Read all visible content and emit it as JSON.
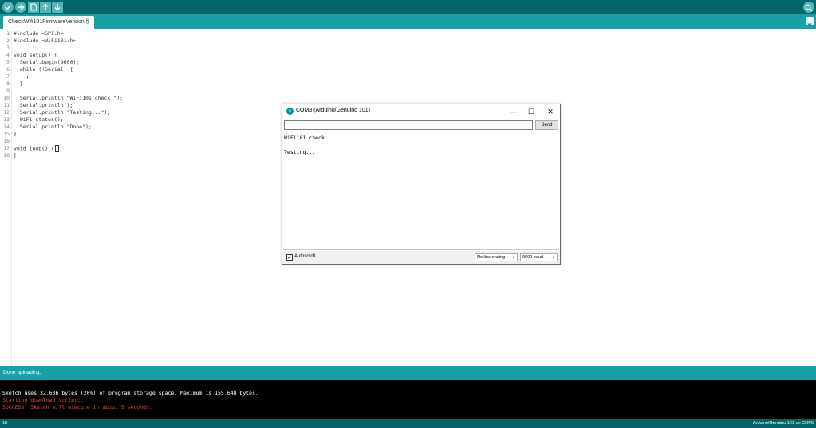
{
  "toolbar": {
    "buttons": [
      {
        "name": "verify",
        "icon": "checkmark-icon"
      },
      {
        "name": "upload",
        "icon": "arrow-right-icon"
      },
      {
        "name": "new",
        "icon": "new-file-icon"
      },
      {
        "name": "open",
        "icon": "arrow-up-icon"
      },
      {
        "name": "save",
        "icon": "arrow-down-icon"
      }
    ],
    "serial_monitor_icon": "magnifier-icon"
  },
  "tabs": [
    {
      "label": "CheckWifi101FirmwareVersion §"
    }
  ],
  "editor": {
    "line_numbers": [
      "1",
      "2",
      "3",
      "4",
      "5",
      "6",
      "7",
      "8",
      "9",
      "10",
      "11",
      "12",
      "13",
      "14",
      "15",
      "16",
      "17",
      "18"
    ],
    "lines": [
      "#include <SPI.h>",
      "#include <WiFi101.h>",
      "",
      "void setup() {",
      "  Serial.begin(9600);",
      "  while (!Serial) {",
      "    ;",
      "  }",
      "",
      "  Serial.println(\"WiFi101 check.\");",
      "  Serial.println();",
      "  Serial.println(\"Testing...\");",
      "  WiFi.status();",
      "  Serial.println(\"Done\");",
      "}",
      "",
      "void loop() {",
      "}"
    ]
  },
  "serial_monitor": {
    "title": "COM3 (Arduino/Genuino 101)",
    "input_value": "",
    "send_label": "Send",
    "output_lines": [
      "WiFi101 check.",
      "",
      "Testing..."
    ],
    "autoscroll_label": "Autoscroll",
    "autoscroll_checked": true,
    "line_ending": "No line ending",
    "baud": "9600 baud",
    "minimize_glyph": "—",
    "maximize_glyph": "☐",
    "close_glyph": "✕"
  },
  "status": {
    "message": "Done uploading."
  },
  "console": {
    "lines": [
      {
        "text": "Sketch uses 32,636 bytes (20%) of program storage space. Maximum is 155,648 bytes.",
        "color": "#ffffff"
      },
      {
        "text": "Starting download script...",
        "color": "#e34c26"
      },
      {
        "text": "SUCCESS: Sketch will execute in about 5 seconds.",
        "color": "#e34c26"
      }
    ]
  },
  "footer": {
    "line_number": "18",
    "board": "Arduino/Genuino 101 on COM3"
  },
  "colors": {
    "toolbar": "#006468",
    "tabbar": "#17a1a5",
    "accent": "#4db7bb",
    "console_bg": "#000000",
    "console_error": "#e34c26"
  }
}
